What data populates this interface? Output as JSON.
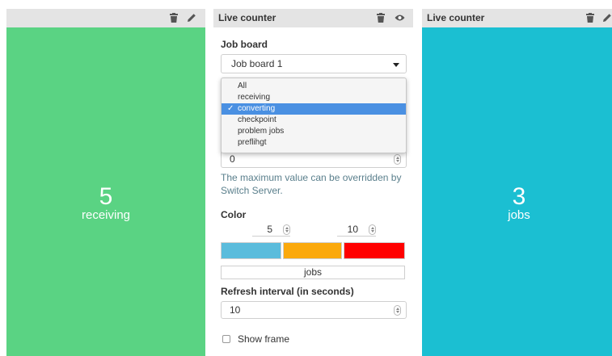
{
  "left_widget": {
    "title": "",
    "count": "5",
    "label": "receiving",
    "bg_color": "#5ad383",
    "icons": [
      "trash-icon",
      "pencil-icon"
    ]
  },
  "settings": {
    "title": "Live counter",
    "icons": [
      "trash-icon",
      "eye-icon"
    ],
    "job_board_label": "Job board",
    "job_board_value": "Job board 1",
    "dropdown_options": [
      "All",
      "receiving",
      "converting",
      "checkpoint",
      "problem jobs",
      "preflihgt"
    ],
    "dropdown_selected": "converting",
    "max_value": "0",
    "max_hint": "The maximum value can be overridden by Switch Server.",
    "color_label": "Color",
    "color_threshold_1": "5",
    "color_threshold_2": "10",
    "swatches": [
      "#5bbcdc",
      "#fba90c",
      "#ff0000"
    ],
    "label_text": "jobs",
    "refresh_label": "Refresh interval (in seconds)",
    "refresh_value": "10",
    "show_frame_label": "Show frame"
  },
  "right_widget": {
    "title": "Live counter",
    "count": "3",
    "label": "jobs",
    "bg_color": "#1bbfd2",
    "icons": [
      "trash-icon",
      "pencil-icon"
    ]
  }
}
